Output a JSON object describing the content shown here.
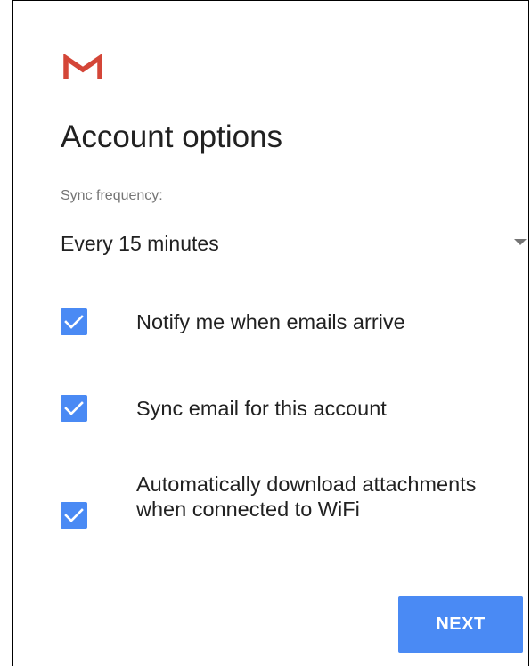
{
  "app": {
    "logo_icon": "gmail-m-icon",
    "colors": {
      "accent": "#4a8af4",
      "logo_red": "#d44638",
      "text_primary": "#212121",
      "text_secondary": "#757575"
    }
  },
  "header": {
    "title": "Account options"
  },
  "sync": {
    "label": "Sync frequency:",
    "selected": "Every 15 minutes",
    "icon": "dropdown-arrow-icon"
  },
  "options": [
    {
      "label": "Notify me when emails arrive",
      "checked": true,
      "icon": "checkmark-icon"
    },
    {
      "label": "Sync email for this account",
      "checked": true,
      "icon": "checkmark-icon"
    },
    {
      "label": "Automatically download attachments when connected to WiFi",
      "checked": true,
      "icon": "checkmark-icon"
    }
  ],
  "actions": {
    "next_label": "NEXT"
  }
}
